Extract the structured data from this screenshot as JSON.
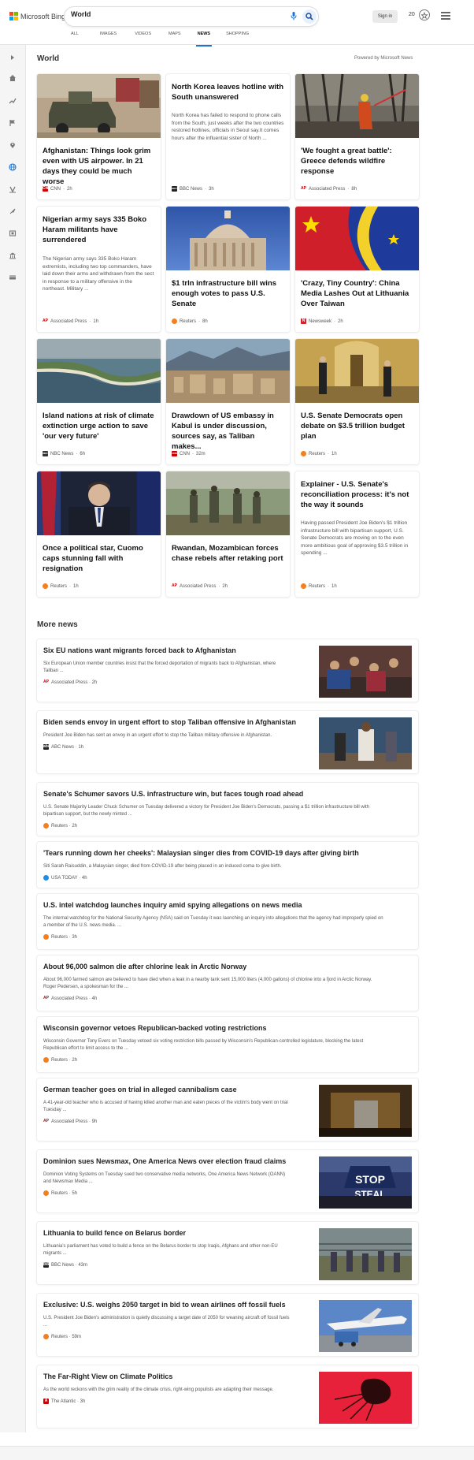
{
  "header": {
    "logo_text": "Microsoft Bing",
    "search_value": "World",
    "signin": "Sign in",
    "rewards": "20",
    "tabs": [
      "ALL",
      "IMAGES",
      "VIDEOS",
      "MAPS",
      "NEWS",
      "SHOPPING"
    ],
    "active_tab": "NEWS"
  },
  "rail": {
    "icons": [
      "expand-icon",
      "home-icon",
      "trending-icon",
      "flag-icon",
      "location-icon",
      "globe-icon",
      "business-icon",
      "rocket-icon",
      "entertainment-icon",
      "politics-icon",
      "money-icon"
    ],
    "active": "globe-icon"
  },
  "world": {
    "title": "World",
    "powered_by": "Powered by Microsoft News",
    "cards": [
      {
        "title": "Afghanistan: Things look grim even with US airpower. In 21 days they could be much worse",
        "snippet": "",
        "source": "CNN",
        "time": "2h",
        "badge": "CNN",
        "badge_color": "#cc0000",
        "img": "military-vehicle-photo"
      },
      {
        "title": "North Korea leaves hotline with South unanswered",
        "snippet": "North Korea has failed to respond to phone calls from the South, just weeks after the two countries restored hotlines, officials in Seoul say.It comes hours after the influential sister of North ...",
        "source": "BBC News",
        "time": "3h",
        "badge": "BBC",
        "badge_color": "#222",
        "img": ""
      },
      {
        "title": "'We fought a great battle': Greece defends wildfire response",
        "snippet": "",
        "source": "Associated Press",
        "time": "8h",
        "badge": "AP",
        "badge_color": "#cc0000",
        "img": "wildfire-photo"
      },
      {
        "title": "Nigerian army says 335 Boko Haram militants have surrendered",
        "snippet": "The Nigerian army says 335 Boko Haram extremists, including two top commanders, have laid down their arms and withdrawn from the sect in response to a military offensive in the northeast. Military ...",
        "source": "Associated Press",
        "time": "1h",
        "badge": "AP",
        "badge_color": "#cc0000",
        "img": ""
      },
      {
        "title": "$1 trln infrastructure bill wins enough votes to pass U.S. Senate",
        "snippet": "",
        "source": "Reuters",
        "time": "8h",
        "badge": "R",
        "badge_color": "#f08020",
        "img": "capitol-photo"
      },
      {
        "title": "'Crazy, Tiny Country': China Media Lashes Out at Lithuania Over Taiwan",
        "snippet": "",
        "source": "Newsweek",
        "time": "2h",
        "badge": "N",
        "badge_color": "#d4212a",
        "img": "flags-photo"
      },
      {
        "title": "Island nations at risk of climate extinction urge action to save 'our very future'",
        "snippet": "",
        "source": "NBC News",
        "time": "6h",
        "badge": "NBC",
        "badge_color": "#333",
        "img": "island-photo"
      },
      {
        "title": "Drawdown of US embassy in Kabul is under discussion, sources say, as Taliban makes...",
        "snippet": "",
        "source": "CNN",
        "time": "32m",
        "badge": "CNN",
        "badge_color": "#cc0000",
        "img": "kabul-photo"
      },
      {
        "title": "U.S. Senate Democrats open debate on $3.5 trillion budget plan",
        "snippet": "",
        "source": "Reuters",
        "time": "1h",
        "badge": "R",
        "badge_color": "#f08020",
        "img": "senate-hallway-photo"
      },
      {
        "title": "Once a political star, Cuomo caps stunning fall with resignation",
        "snippet": "",
        "source": "Reuters",
        "time": "1h",
        "badge": "R",
        "badge_color": "#f08020",
        "img": "cuomo-photo"
      },
      {
        "title": "Rwandan, Mozambican forces chase rebels after retaking port",
        "snippet": "",
        "source": "Associated Press",
        "time": "2h",
        "badge": "AP",
        "badge_color": "#cc0000",
        "img": "soldiers-photo"
      },
      {
        "title": "Explainer - U.S. Senate's reconciliation process: it's not the way it sounds",
        "snippet": "Having passed President Joe Biden's $1 trillion infrastructure bill with bipartisan support, U.S. Senate Democrats are moving on to the even more ambitious goal of approving $3.5 trillion in spending ...",
        "source": "Reuters",
        "time": "1h",
        "badge": "R",
        "badge_color": "#f08020",
        "img": ""
      }
    ]
  },
  "more_news": {
    "title": "More news",
    "items": [
      {
        "title": "Six EU nations want migrants forced back to Afghanistan",
        "snippet": [
          "Six European Union member countries insist that the forced deportation of migrants back to Afghanistan, where",
          "Taliban ..."
        ],
        "source": "Associated Press",
        "time": "2h",
        "badge": "AP",
        "badge_color": "#cc0000",
        "img": "migrants-photo"
      },
      {
        "title": "Biden sends envoy in urgent effort to stop Taliban offensive in Afghanistan",
        "snippet": [
          "President Joe Biden has sent an envoy in an urgent effort to stop the Taliban military offensive in Afghanistan."
        ],
        "source": "ABC News",
        "time": "1h",
        "badge": "abc",
        "badge_color": "#222",
        "img": "envoy-photo"
      },
      {
        "title": "Senate's Schumer savors U.S. infrastructure win, but faces tough road ahead",
        "snippet": [
          "U.S. Senate Majority Leader Chuck Schumer on Tuesday delivered a victory for President Joe Biden's Democrats, passing a $1 trillion infrastructure bill with",
          "bipartisan support, but the newly minted ..."
        ],
        "source": "Reuters",
        "time": "2h",
        "badge": "R",
        "badge_color": "#f08020",
        "img": ""
      },
      {
        "title": "'Tears running down her cheeks': Malaysian singer dies from COVID-19 days after giving birth",
        "snippet": [
          "Siti Sarah Raisuddin, a Malaysian singer, died from COVID-19 after being placed in an induced coma to give birth."
        ],
        "source": "USA TODAY",
        "time": "4h",
        "badge": "",
        "badge_color": "#1a8fe3",
        "img": ""
      },
      {
        "title": "U.S. intel watchdog launches inquiry amid spying allegations on news media",
        "snippet": [
          "The internal watchdog for the National Security Agency (NSA) said on Tuesday it was launching an inquiry into allegations that the agency had improperly spied on",
          "a member of the U.S. news media. ..."
        ],
        "source": "Reuters",
        "time": "3h",
        "badge": "R",
        "badge_color": "#f08020",
        "img": ""
      },
      {
        "title": "About 96,000 salmon die after chlorine leak in Arctic Norway",
        "snippet": [
          "About 96,000 farmed salmon are believed to have died when a leak in a nearby tank sent 15,000 liters (4,000 gallons) of chlorine into a fjord in Arctic Norway.",
          "Roger Pedersen, a spokesman for the ..."
        ],
        "source": "Associated Press",
        "time": "4h",
        "badge": "AP",
        "badge_color": "#cc0000",
        "img": ""
      },
      {
        "title": "Wisconsin governor vetoes Republican-backed voting restrictions",
        "snippet": [
          "Wisconsin Governor Tony Evers on Tuesday vetoed six voting restriction bills passed by Wisconsin's Republican-controlled legislature, blocking the latest",
          "Republican effort to limit access to the ..."
        ],
        "source": "Reuters",
        "time": "2h",
        "badge": "R",
        "badge_color": "#f08020",
        "img": ""
      },
      {
        "title": "German teacher goes on trial in alleged cannibalism case",
        "snippet": [
          "A 41-year-old teacher who is accused of having killed another man and eaten pieces of the victim's body went on trial",
          "Tuesday ..."
        ],
        "source": "Associated Press",
        "time": "9h",
        "badge": "AP",
        "badge_color": "#cc0000",
        "img": "courtroom-photo"
      },
      {
        "title": "Dominion sues Newsmax, One America News over election fraud claims",
        "snippet": [
          "Dominion Voting Systems on Tuesday sued two conservative media networks, One America News Network (OANN)",
          "and Newsmax Media ..."
        ],
        "source": "Reuters",
        "time": "5h",
        "badge": "R",
        "badge_color": "#f08020",
        "img": "stop-steal-photo"
      },
      {
        "title": "Lithuania to build fence on Belarus border",
        "snippet": [
          "Lithuania's parliament has voted to build a fence on the Belarus border to stop Iraqis, Afghans and other non-EU",
          "migrants ..."
        ],
        "source": "BBC News",
        "time": "43m",
        "badge": "BBC",
        "badge_color": "#222",
        "img": "border-photo"
      },
      {
        "title": "Exclusive: U.S. weighs 2050 target in bid to wean airlines off fossil fuels",
        "snippet": [
          "U.S. President Joe Biden's administration is quietly discussing a target date of 2050 for weaning aircraft off fossil fuels",
          "..."
        ],
        "source": "Reuters",
        "time": "59m",
        "badge": "R",
        "badge_color": "#f08020",
        "img": "airplane-photo"
      },
      {
        "title": "The Far-Right View on Climate Politics",
        "snippet": [
          "As the world reckons with the grim reality of the climate crisis, right-wing populists are adapting their message."
        ],
        "source": "The Atlantic",
        "time": "3h",
        "badge": "A",
        "badge_color": "#c00",
        "img": "red-illustration"
      }
    ]
  }
}
